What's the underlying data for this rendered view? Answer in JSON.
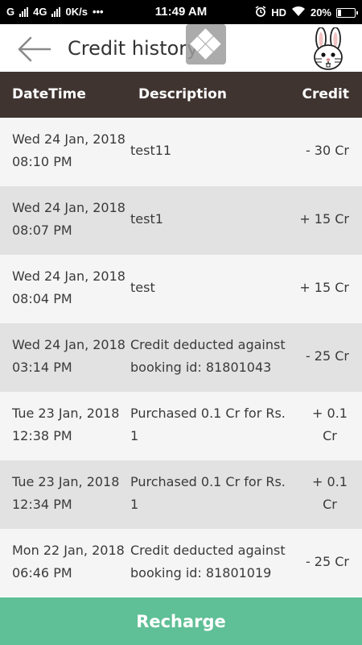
{
  "status_bar": {
    "carrier_left": "G",
    "network": "4G",
    "speed": "0K/s",
    "dots": "•••",
    "time": "11:49 AM",
    "hd": "HD",
    "battery": "20%"
  },
  "header": {
    "title": "Credit history"
  },
  "table": {
    "columns": [
      "DateTime",
      "Description",
      "Credit"
    ],
    "rows": [
      {
        "date": "Wed 24 Jan, 2018",
        "time": "08:10 PM",
        "desc": [
          "test11"
        ],
        "credit": [
          "- 30 Cr"
        ]
      },
      {
        "date": "Wed 24 Jan, 2018",
        "time": "08:07 PM",
        "desc": [
          "test1"
        ],
        "credit": [
          "+ 15 Cr"
        ]
      },
      {
        "date": "Wed 24 Jan, 2018",
        "time": "08:04 PM",
        "desc": [
          "test"
        ],
        "credit": [
          "+ 15 Cr"
        ]
      },
      {
        "date": "Wed 24 Jan, 2018",
        "time": "03:14 PM",
        "desc": [
          "Credit deducted against",
          "booking id: 81801043"
        ],
        "credit": [
          "- 25 Cr"
        ]
      },
      {
        "date": "Tue 23 Jan, 2018",
        "time": "12:38 PM",
        "desc": [
          "Purchased 0.1 Cr for Rs.",
          "1"
        ],
        "credit": [
          "+ 0.1",
          "Cr"
        ]
      },
      {
        "date": "Tue 23 Jan, 2018",
        "time": "12:34 PM",
        "desc": [
          "Purchased 0.1 Cr for Rs.",
          "1"
        ],
        "credit": [
          "+ 0.1",
          "Cr"
        ]
      },
      {
        "date": "Mon 22 Jan, 2018",
        "time": "06:46 PM",
        "desc": [
          "Credit deducted against",
          "booking id: 81801019"
        ],
        "credit": [
          "- 25 Cr"
        ]
      }
    ]
  },
  "footer": {
    "recharge_label": "Recharge"
  },
  "colors": {
    "header_bg": "#3f3430",
    "row_light": "#f5f5f5",
    "row_dark": "#e2e2e2",
    "accent": "#5fbf96"
  }
}
